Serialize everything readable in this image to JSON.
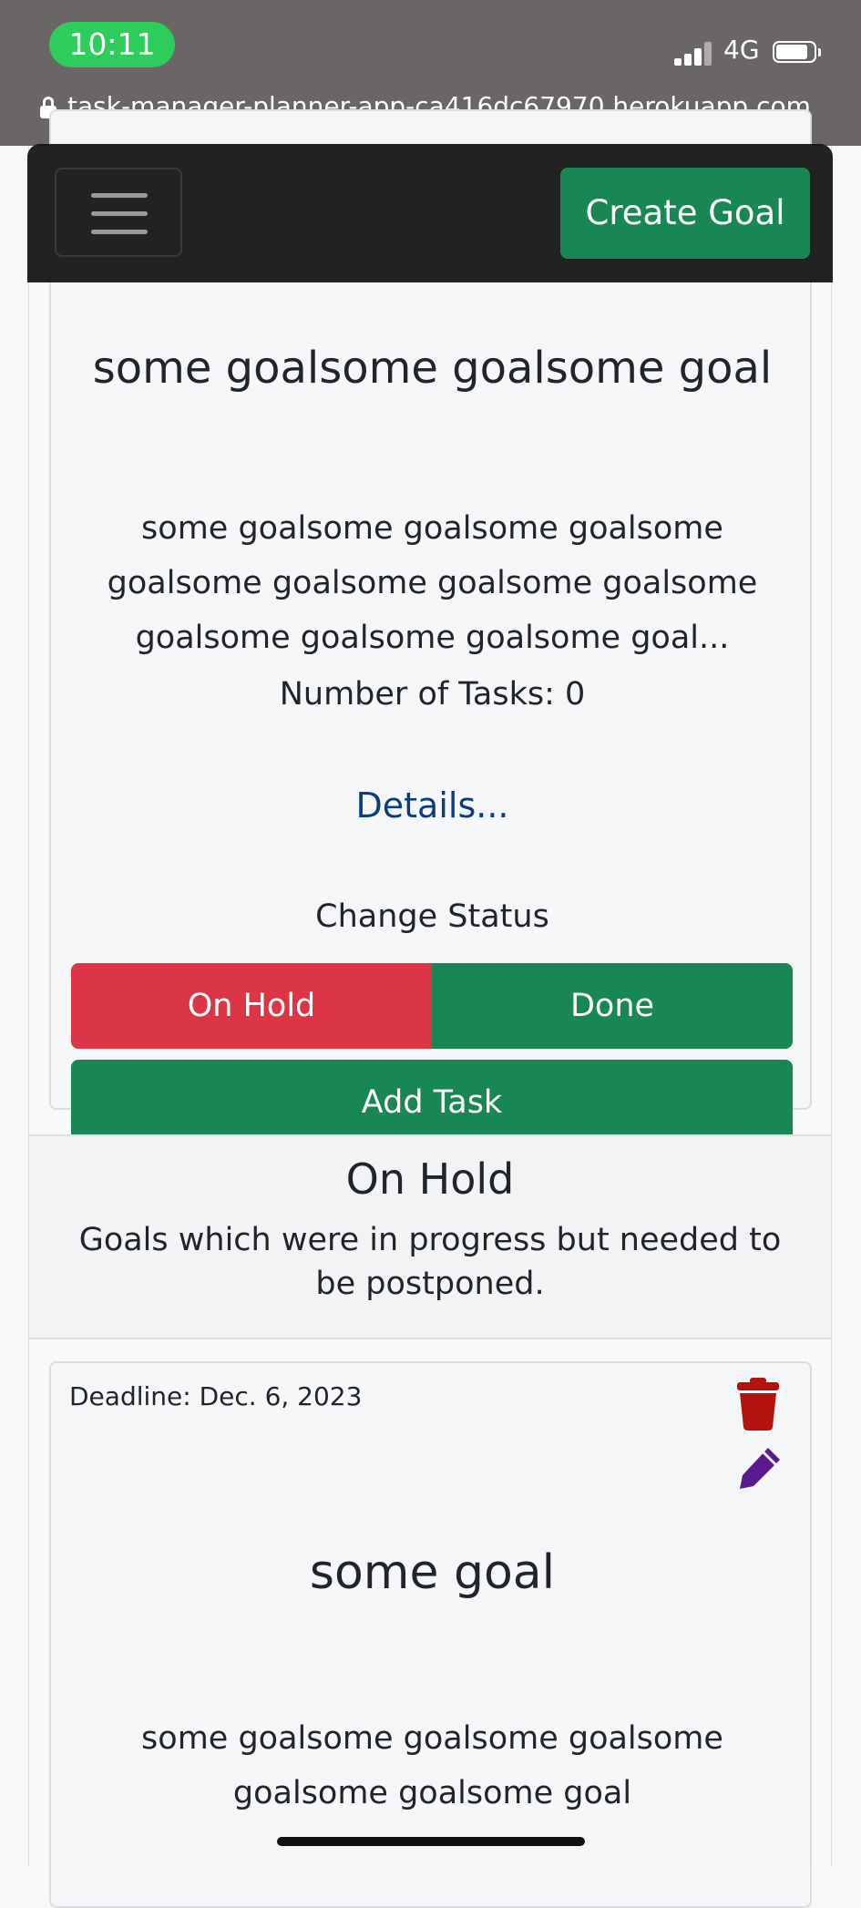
{
  "status_bar": {
    "time": "10:11",
    "network": "4G"
  },
  "browser": {
    "url": "task-manager-planner-app-ca416dc67970.herokuapp.com"
  },
  "navbar": {
    "create_goal_label": "Create Goal"
  },
  "goal_card_1": {
    "title": "some goalsome goalsome goal",
    "description": "some goalsome goalsome goalsome goalsome goalsome goalsome goalsome goalsome goalsome goalsome goal...",
    "task_count": "Number of Tasks: 0",
    "details_link": "Details...",
    "change_status_label": "Change Status",
    "on_hold_button": "On Hold",
    "done_button": "Done",
    "add_task_button": "Add Task"
  },
  "on_hold_section": {
    "title": "On Hold",
    "description": "Goals which were in progress but needed to be postponed."
  },
  "goal_card_2": {
    "deadline": "Deadline: Dec. 6, 2023",
    "title": "some goal",
    "description": "some goalsome goalsome goalsome goalsome goalsome goal",
    "delete_icon": "trash-icon",
    "edit_icon": "pencil-icon"
  },
  "colors": {
    "success": "#198754",
    "danger": "#dc3545",
    "link": "#0b3d7a",
    "delete": "#b5120e",
    "edit": "#5b1a8e",
    "status_bar_bg": "#6a6666",
    "time_pill": "#2ecc5a"
  }
}
